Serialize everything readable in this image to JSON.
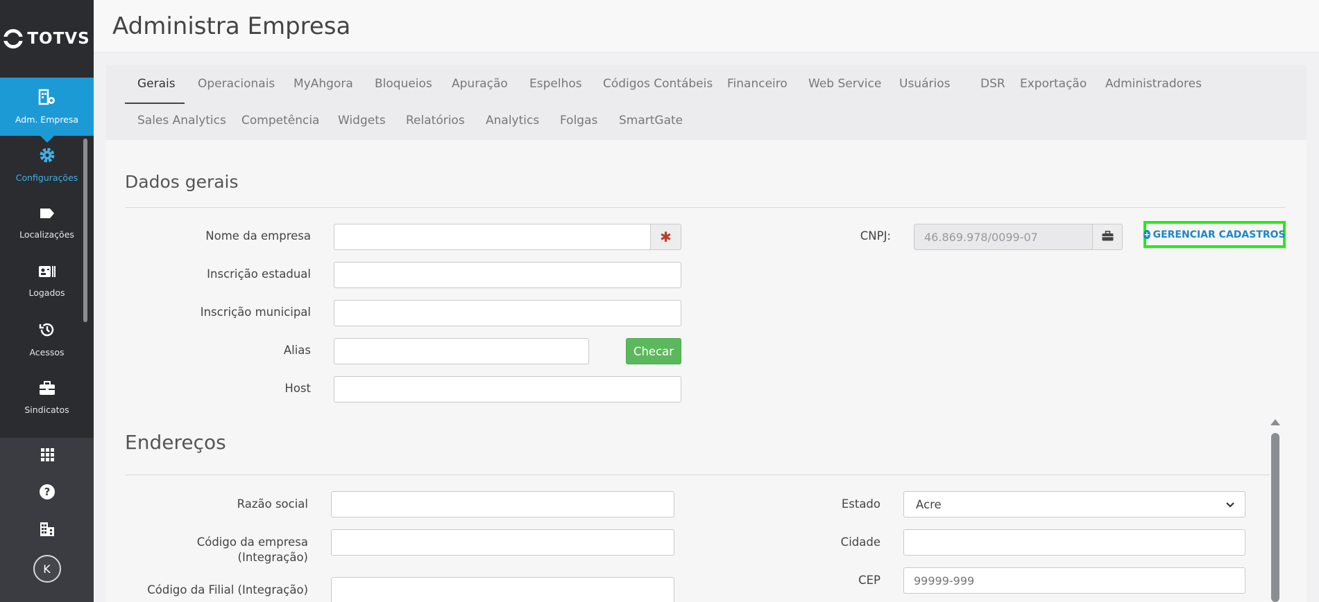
{
  "brand": {
    "name": "TOTVS"
  },
  "page": {
    "title": "Administra Empresa"
  },
  "sidebar": {
    "items": [
      {
        "label": "Adm. Empresa",
        "icon": "building-gear-icon"
      },
      {
        "label": "Configurações",
        "icon": "gear-icon"
      },
      {
        "label": "Localizações",
        "icon": "tag-icon"
      },
      {
        "label": "Logados",
        "icon": "id-card-icon"
      },
      {
        "label": "Acessos",
        "icon": "history-icon"
      },
      {
        "label": "Sindicatos",
        "icon": "briefcase-icon"
      }
    ],
    "bottom": [
      {
        "icon": "grid-icon"
      },
      {
        "icon": "help-icon"
      },
      {
        "icon": "company-icon"
      }
    ],
    "avatar_initial": "K"
  },
  "tabs": {
    "row1": [
      "Gerais",
      "Operacionais",
      "MyAhgora",
      "Bloqueios",
      "Apuração",
      "Espelhos",
      "Códigos Contábeis",
      "Financeiro",
      "Web Service",
      "Usuários",
      "DSR",
      "Exportação",
      "Administradores"
    ],
    "row2": [
      "Sales Analytics",
      "Competência",
      "Widgets",
      "Relatórios",
      "Analytics",
      "Folgas",
      "SmartGate"
    ],
    "active": "Gerais"
  },
  "dados_gerais": {
    "title": "Dados gerais",
    "nome_empresa_label": "Nome da empresa",
    "nome_empresa_value": "",
    "required_mark": "✱",
    "inscricao_estadual_label": "Inscrição estadual",
    "inscricao_estadual_value": "",
    "inscricao_municipal_label": "Inscrição municipal",
    "inscricao_municipal_value": "",
    "alias_label": "Alias",
    "alias_value": "",
    "checar_label": "Checar",
    "host_label": "Host",
    "host_value": "",
    "cnpj_label": "CNPJ:",
    "cnpj_value": "46.869.978/0099-07",
    "gerenciar_label": "GERENCIAR CADASTROS"
  },
  "enderecos": {
    "title": "Endereços",
    "razao_social_label": "Razão social",
    "razao_social_value": "",
    "codigo_empresa_label_1": "Código da empresa",
    "codigo_empresa_label_2": "(Integração)",
    "codigo_empresa_value": "",
    "codigo_filial_label": "Código da Filial (Integração)",
    "codigo_filial_value": "",
    "estado_label": "Estado",
    "estado_value": "Acre",
    "cidade_label": "Cidade",
    "cidade_value": "",
    "cep_label": "CEP",
    "cep_placeholder": "99999-999"
  },
  "colors": {
    "sidebar_bg": "#2a2c30",
    "active_blue": "#1c9ad6",
    "green": "#5cb85c",
    "highlight_border": "#22ee11",
    "link_blue": "#1c87c9"
  }
}
